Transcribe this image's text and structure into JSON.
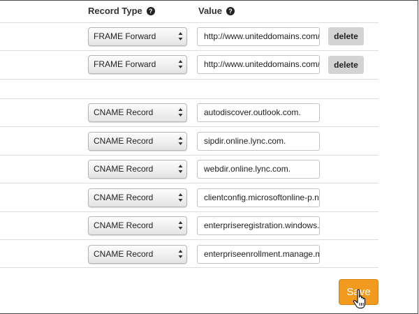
{
  "headers": {
    "record_type": "Record Type",
    "value": "Value"
  },
  "rows": [
    {
      "type": "FRAME Forward",
      "value": "http://www.uniteddomains.com/",
      "action": "delete"
    },
    {
      "type": "FRAME Forward",
      "value": "http://www.uniteddomains.com/",
      "action": "delete"
    },
    {
      "type": "CNAME Record",
      "value": "autodiscover.outlook.com."
    },
    {
      "type": "CNAME Record",
      "value": "sipdir.online.lync.com."
    },
    {
      "type": "CNAME Record",
      "value": "webdir.online.lync.com."
    },
    {
      "type": "CNAME Record",
      "value": "clientconfig.microsoftonline-p.net."
    },
    {
      "type": "CNAME Record",
      "value": "enterpriseregistration.windows.net."
    },
    {
      "type": "CNAME Record",
      "value": "enterpriseenrollment.manage.microsoft.com."
    }
  ],
  "save_label": "Save",
  "colors": {
    "save": "#f19a1e",
    "delete": "#d3d3d3",
    "divider": "#dcdcdc"
  },
  "icons": {
    "help": "question-circle-icon",
    "select": "select-arrows-icon",
    "cursor": "hand-pointer-icon"
  }
}
